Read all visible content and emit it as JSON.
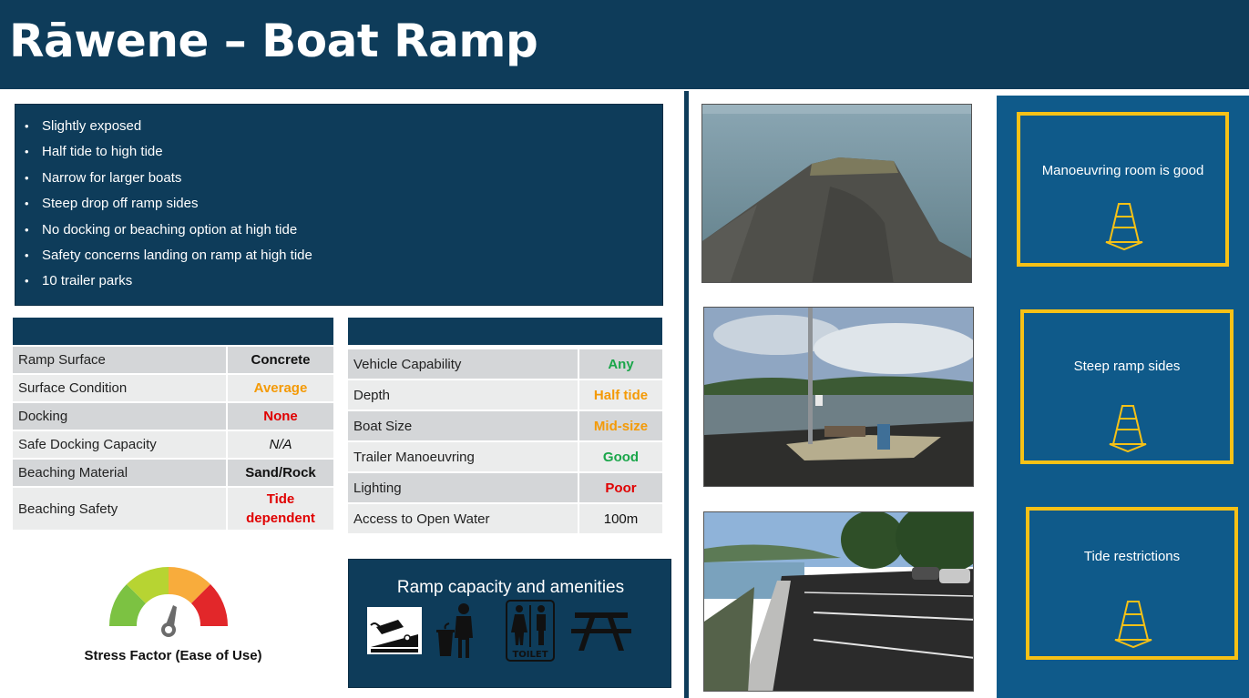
{
  "title": "Rāwene – Boat Ramp",
  "bullets": [
    "Slightly exposed",
    "Half tide to high tide",
    "Narrow for larger boats",
    "Steep drop off ramp sides",
    "No docking or beaching option at high tide",
    "Safety concerns landing on ramp at high tide",
    "10 trailer parks"
  ],
  "bullet_glyph": "•",
  "left_table": {
    "header": "",
    "rows": [
      {
        "label": "Ramp Surface",
        "value": "Concrete",
        "color": "#111111"
      },
      {
        "label": "Surface Condition",
        "value": "Average",
        "color": "#f49a06"
      },
      {
        "label": "Docking",
        "value": "None",
        "color": "#e00000"
      },
      {
        "label": "Safe Docking Capacity",
        "value": "N/A",
        "color": "#111111"
      },
      {
        "label": "Beaching Material",
        "value": "Sand/Rock",
        "color": "#111111"
      },
      {
        "label": "Beaching Safety",
        "value": "Tide dependent",
        "color": "#e00000"
      }
    ]
  },
  "right_table": {
    "header": "",
    "rows": [
      {
        "label": "Vehicle Capability",
        "value": "Any",
        "color": "#1aa64a"
      },
      {
        "label": "Depth",
        "value": "Half tide",
        "color": "#f49a06"
      },
      {
        "label": "Boat Size",
        "value": "Mid-size",
        "color": "#f49a06"
      },
      {
        "label": "Trailer Manoeuvring",
        "value": "Good",
        "color": "#1aa64a"
      },
      {
        "label": "Lighting",
        "value": "Poor",
        "color": "#e00000"
      },
      {
        "label": "Access to Open Water",
        "value": "100m",
        "color": "#111111"
      }
    ]
  },
  "stress_factor": {
    "label": "Stress Factor (Ease of Use)",
    "segment_colors": [
      "#7cc242",
      "#b7d432",
      "#f8ac3c",
      "#e2272a"
    ],
    "icon": "gauge-needle-icon"
  },
  "amenities": {
    "title": "Ramp capacity and amenities",
    "icons": [
      "boat-ramp-icon",
      "rubbish-bin-icon",
      "toilet-icon",
      "picnic-table-icon"
    ],
    "toilet_text": "TOILET"
  },
  "photos": [
    "ramp-photo",
    "ramp-foreshore-photo",
    "carpark-photo"
  ],
  "warnings": [
    {
      "text": "Manoeuvring room is good",
      "icon": "traffic-cone-icon"
    },
    {
      "text": "Steep ramp sides",
      "icon": "traffic-cone-icon"
    },
    {
      "text": "Tide restrictions",
      "icon": "traffic-cone-icon"
    }
  ],
  "colors": {
    "navy": "#0e3c5a",
    "panel_blue": "#0f5a8a",
    "warning_yellow": "#f6c116"
  }
}
